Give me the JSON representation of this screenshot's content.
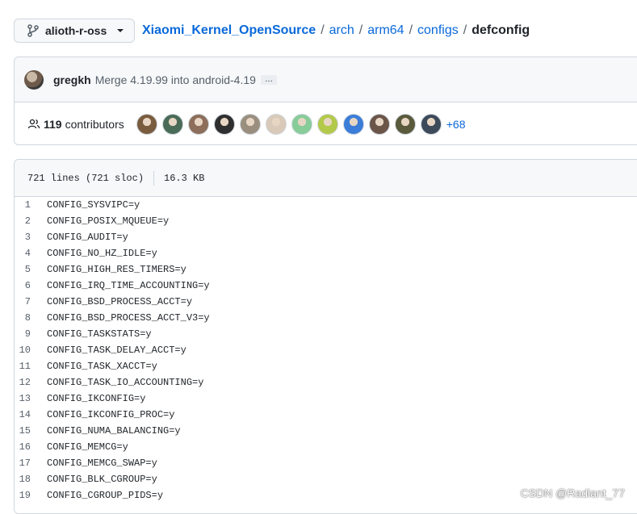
{
  "branch": {
    "name": "alioth-r-oss"
  },
  "breadcrumb": {
    "repo": "Xiaomi_Kernel_OpenSource",
    "parts": [
      "arch",
      "arm64",
      "configs"
    ],
    "separator": "/",
    "file": "defconfig"
  },
  "commit": {
    "author": "gregkh",
    "message": "Merge 4.19.99 into android-4.19",
    "ellipsis": "…"
  },
  "contributors": {
    "count": "119",
    "label": "contributors",
    "more": "+68",
    "avatar_colors": [
      "#7a5c3e",
      "#4a6b58",
      "#8d6e5a",
      "#2f2f2f",
      "#9a8f7f",
      "#d9c9b8",
      "#88cc99",
      "#b3c94a",
      "#3b7dd8",
      "#6b5548",
      "#5a5a3c",
      "#3c4a5a"
    ]
  },
  "file_info": {
    "lines": "721 lines (721 sloc)",
    "size": "16.3 KB"
  },
  "code_lines": [
    {
      "num": "1",
      "text": "CONFIG_SYSVIPC=y"
    },
    {
      "num": "2",
      "text": "CONFIG_POSIX_MQUEUE=y"
    },
    {
      "num": "3",
      "text": "CONFIG_AUDIT=y"
    },
    {
      "num": "4",
      "text": "CONFIG_NO_HZ_IDLE=y"
    },
    {
      "num": "5",
      "text": "CONFIG_HIGH_RES_TIMERS=y"
    },
    {
      "num": "6",
      "text": "CONFIG_IRQ_TIME_ACCOUNTING=y"
    },
    {
      "num": "7",
      "text": "CONFIG_BSD_PROCESS_ACCT=y"
    },
    {
      "num": "8",
      "text": "CONFIG_BSD_PROCESS_ACCT_V3=y"
    },
    {
      "num": "9",
      "text": "CONFIG_TASKSTATS=y"
    },
    {
      "num": "10",
      "text": "CONFIG_TASK_DELAY_ACCT=y"
    },
    {
      "num": "11",
      "text": "CONFIG_TASK_XACCT=y"
    },
    {
      "num": "12",
      "text": "CONFIG_TASK_IO_ACCOUNTING=y"
    },
    {
      "num": "13",
      "text": "CONFIG_IKCONFIG=y"
    },
    {
      "num": "14",
      "text": "CONFIG_IKCONFIG_PROC=y"
    },
    {
      "num": "15",
      "text": "CONFIG_NUMA_BALANCING=y"
    },
    {
      "num": "16",
      "text": "CONFIG_MEMCG=y"
    },
    {
      "num": "17",
      "text": "CONFIG_MEMCG_SWAP=y"
    },
    {
      "num": "18",
      "text": "CONFIG_BLK_CGROUP=y"
    },
    {
      "num": "19",
      "text": "CONFIG_CGROUP_PIDS=y"
    }
  ],
  "watermark": "CSDN @Radiant_77"
}
